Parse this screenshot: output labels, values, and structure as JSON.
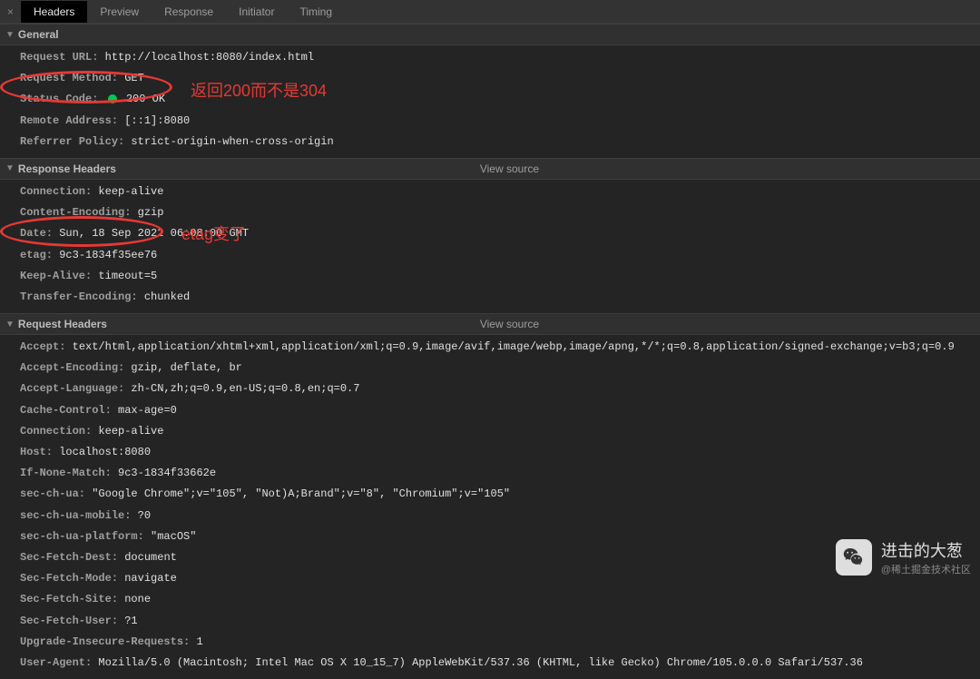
{
  "tabs": {
    "headers": "Headers",
    "preview": "Preview",
    "response": "Response",
    "initiator": "Initiator",
    "timing": "Timing"
  },
  "sections": {
    "general": {
      "title": "General",
      "rows": {
        "request_url": {
          "label": "Request URL:",
          "value": "http://localhost:8080/index.html"
        },
        "request_method": {
          "label": "Request Method:",
          "value": "GET"
        },
        "status_code": {
          "label": "Status Code:",
          "value": "200 OK"
        },
        "remote_address": {
          "label": "Remote Address:",
          "value": "[::1]:8080"
        },
        "referrer_policy": {
          "label": "Referrer Policy:",
          "value": "strict-origin-when-cross-origin"
        }
      }
    },
    "response_headers": {
      "title": "Response Headers",
      "view_source": "View source",
      "rows": {
        "connection": {
          "label": "Connection:",
          "value": "keep-alive"
        },
        "content_encoding": {
          "label": "Content-Encoding:",
          "value": "gzip"
        },
        "date": {
          "label": "Date:",
          "value": "Sun, 18 Sep 2022 06:08:00 GMT"
        },
        "etag": {
          "label": "etag:",
          "value": "9c3-1834f35ee76"
        },
        "keep_alive": {
          "label": "Keep-Alive:",
          "value": "timeout=5"
        },
        "transfer_encoding": {
          "label": "Transfer-Encoding:",
          "value": "chunked"
        }
      }
    },
    "request_headers": {
      "title": "Request Headers",
      "view_source": "View source",
      "rows": {
        "accept": {
          "label": "Accept:",
          "value": "text/html,application/xhtml+xml,application/xml;q=0.9,image/avif,image/webp,image/apng,*/*;q=0.8,application/signed-exchange;v=b3;q=0.9"
        },
        "accept_encoding": {
          "label": "Accept-Encoding:",
          "value": "gzip, deflate, br"
        },
        "accept_language": {
          "label": "Accept-Language:",
          "value": "zh-CN,zh;q=0.9,en-US;q=0.8,en;q=0.7"
        },
        "cache_control": {
          "label": "Cache-Control:",
          "value": "max-age=0"
        },
        "connection": {
          "label": "Connection:",
          "value": "keep-alive"
        },
        "host": {
          "label": "Host:",
          "value": "localhost:8080"
        },
        "if_none_match": {
          "label": "If-None-Match:",
          "value": "9c3-1834f33662e"
        },
        "sec_ch_ua": {
          "label": "sec-ch-ua:",
          "value": "\"Google Chrome\";v=\"105\", \"Not)A;Brand\";v=\"8\", \"Chromium\";v=\"105\""
        },
        "sec_ch_ua_mobile": {
          "label": "sec-ch-ua-mobile:",
          "value": "?0"
        },
        "sec_ch_ua_platform": {
          "label": "sec-ch-ua-platform:",
          "value": "\"macOS\""
        },
        "sec_fetch_dest": {
          "label": "Sec-Fetch-Dest:",
          "value": "document"
        },
        "sec_fetch_mode": {
          "label": "Sec-Fetch-Mode:",
          "value": "navigate"
        },
        "sec_fetch_site": {
          "label": "Sec-Fetch-Site:",
          "value": "none"
        },
        "sec_fetch_user": {
          "label": "Sec-Fetch-User:",
          "value": "?1"
        },
        "upgrade_insecure": {
          "label": "Upgrade-Insecure-Requests:",
          "value": "1"
        },
        "user_agent": {
          "label": "User-Agent:",
          "value": "Mozilla/5.0 (Macintosh; Intel Mac OS X 10_15_7) AppleWebKit/537.36 (KHTML, like Gecko) Chrome/105.0.0.0 Safari/537.36"
        }
      }
    }
  },
  "annotations": {
    "status_note": "返回200而不是304",
    "etag_note": "etag变了"
  },
  "watermark": {
    "title": "进击的大葱",
    "sub": "@稀土掘金技术社区"
  }
}
